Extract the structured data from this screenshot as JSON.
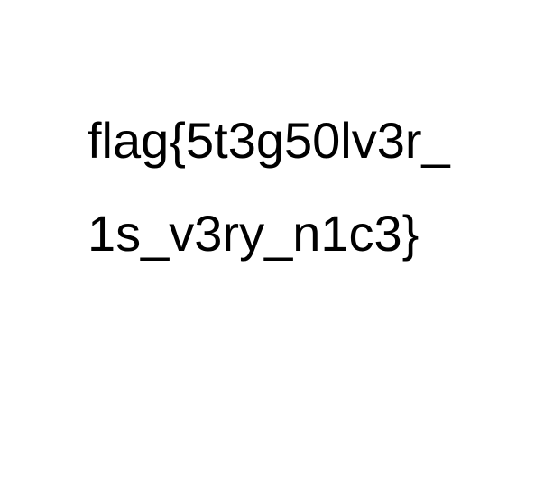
{
  "text": {
    "line1": "flag{5t3g50lv3r_",
    "line2": "1s_v3ry_n1c3}"
  },
  "colors": {
    "background": "#ffffff",
    "text": "#000000"
  }
}
